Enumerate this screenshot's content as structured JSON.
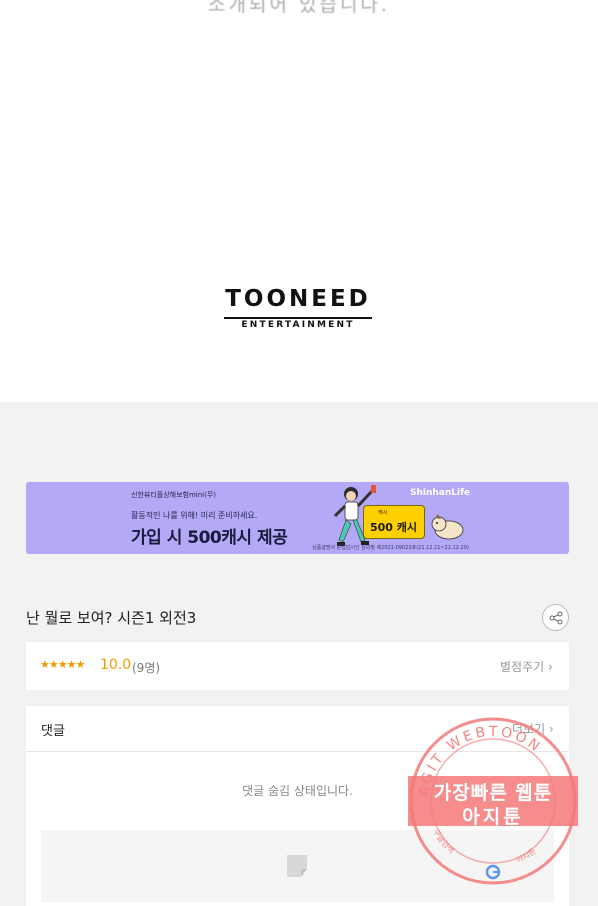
{
  "top_text": "소개되어 있습니다.",
  "logo": {
    "main": "TOONEED",
    "sub": "ENTERTAINMENT"
  },
  "ad": {
    "company": "신한뷰티플상해보험mini(무)",
    "tagline": "활동적인 나를 위해! 미리 준비하세요.",
    "headline": "가입 시 500캐시 제공",
    "brand": "ShinhanLife",
    "cash_label": "500 캐시",
    "disclaimer": "상품설명서 준법감시인 심의필 제2021-09023호(21.12.21~22.12.20)",
    "background_color": "#b4a9f6"
  },
  "episode": {
    "title": "난 뭘로 보여? 시즌1 외전3",
    "share_icon": "share-icon"
  },
  "rating": {
    "stars": "★★★★★",
    "score": "10.0",
    "count": "(9명)",
    "rate_label": "별점주기 ›",
    "star_value": 5,
    "accent_color": "#f09a00"
  },
  "comments": {
    "header": "댓글",
    "more_label": "더보기 ›",
    "hidden_notice": "댓글 숨김 상태입니다."
  },
  "watermark": {
    "ring_top": "AGIT WEBTOON",
    "line1": "가장빠른 웹툰",
    "line2": "아지툰",
    "ring_left": "구글검색",
    "ring_right": "아지툰",
    "color": "#f47878"
  }
}
